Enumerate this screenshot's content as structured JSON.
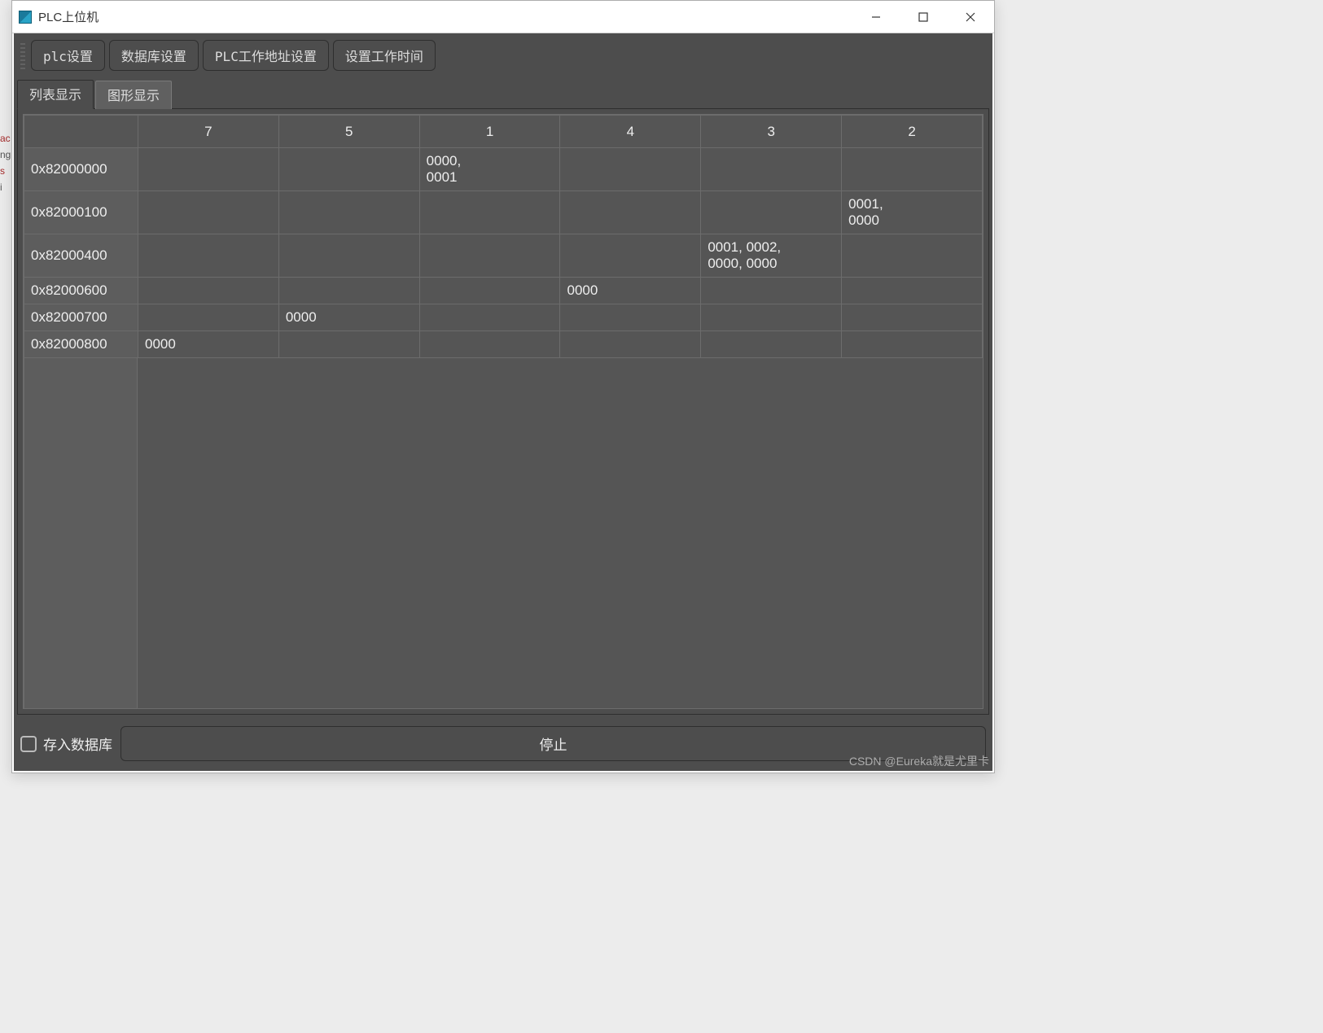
{
  "window": {
    "title": "PLC上位机"
  },
  "toolbar": {
    "buttons": [
      {
        "label": "plc设置"
      },
      {
        "label": "数据库设置"
      },
      {
        "label": "PLC工作地址设置"
      },
      {
        "label": "设置工作时间"
      }
    ]
  },
  "tabs": {
    "list_label": "列表显示",
    "graph_label": "图形显示",
    "active": 0
  },
  "table": {
    "columns": [
      "7",
      "5",
      "1",
      "4",
      "3",
      "2"
    ],
    "rows": [
      {
        "hdr": "0x82000000",
        "cells": {
          "1": "0000, 0001"
        }
      },
      {
        "hdr": "0x82000100",
        "cells": {
          "2": "0001, 0000"
        }
      },
      {
        "hdr": "0x82000400",
        "cells": {
          "3": "0001, 0002, 0000, 0000"
        }
      },
      {
        "hdr": "0x82000600",
        "cells": {
          "4": "0000"
        }
      },
      {
        "hdr": "0x82000700",
        "cells": {
          "5": "0000"
        }
      },
      {
        "hdr": "0x82000800",
        "cells": {
          "7": "0000"
        }
      }
    ]
  },
  "footer": {
    "checkbox_label": "存入数据库",
    "checkbox_checked": false,
    "stop_label": "停止"
  },
  "watermark": "CSDN @Eureka就是尤里卡"
}
